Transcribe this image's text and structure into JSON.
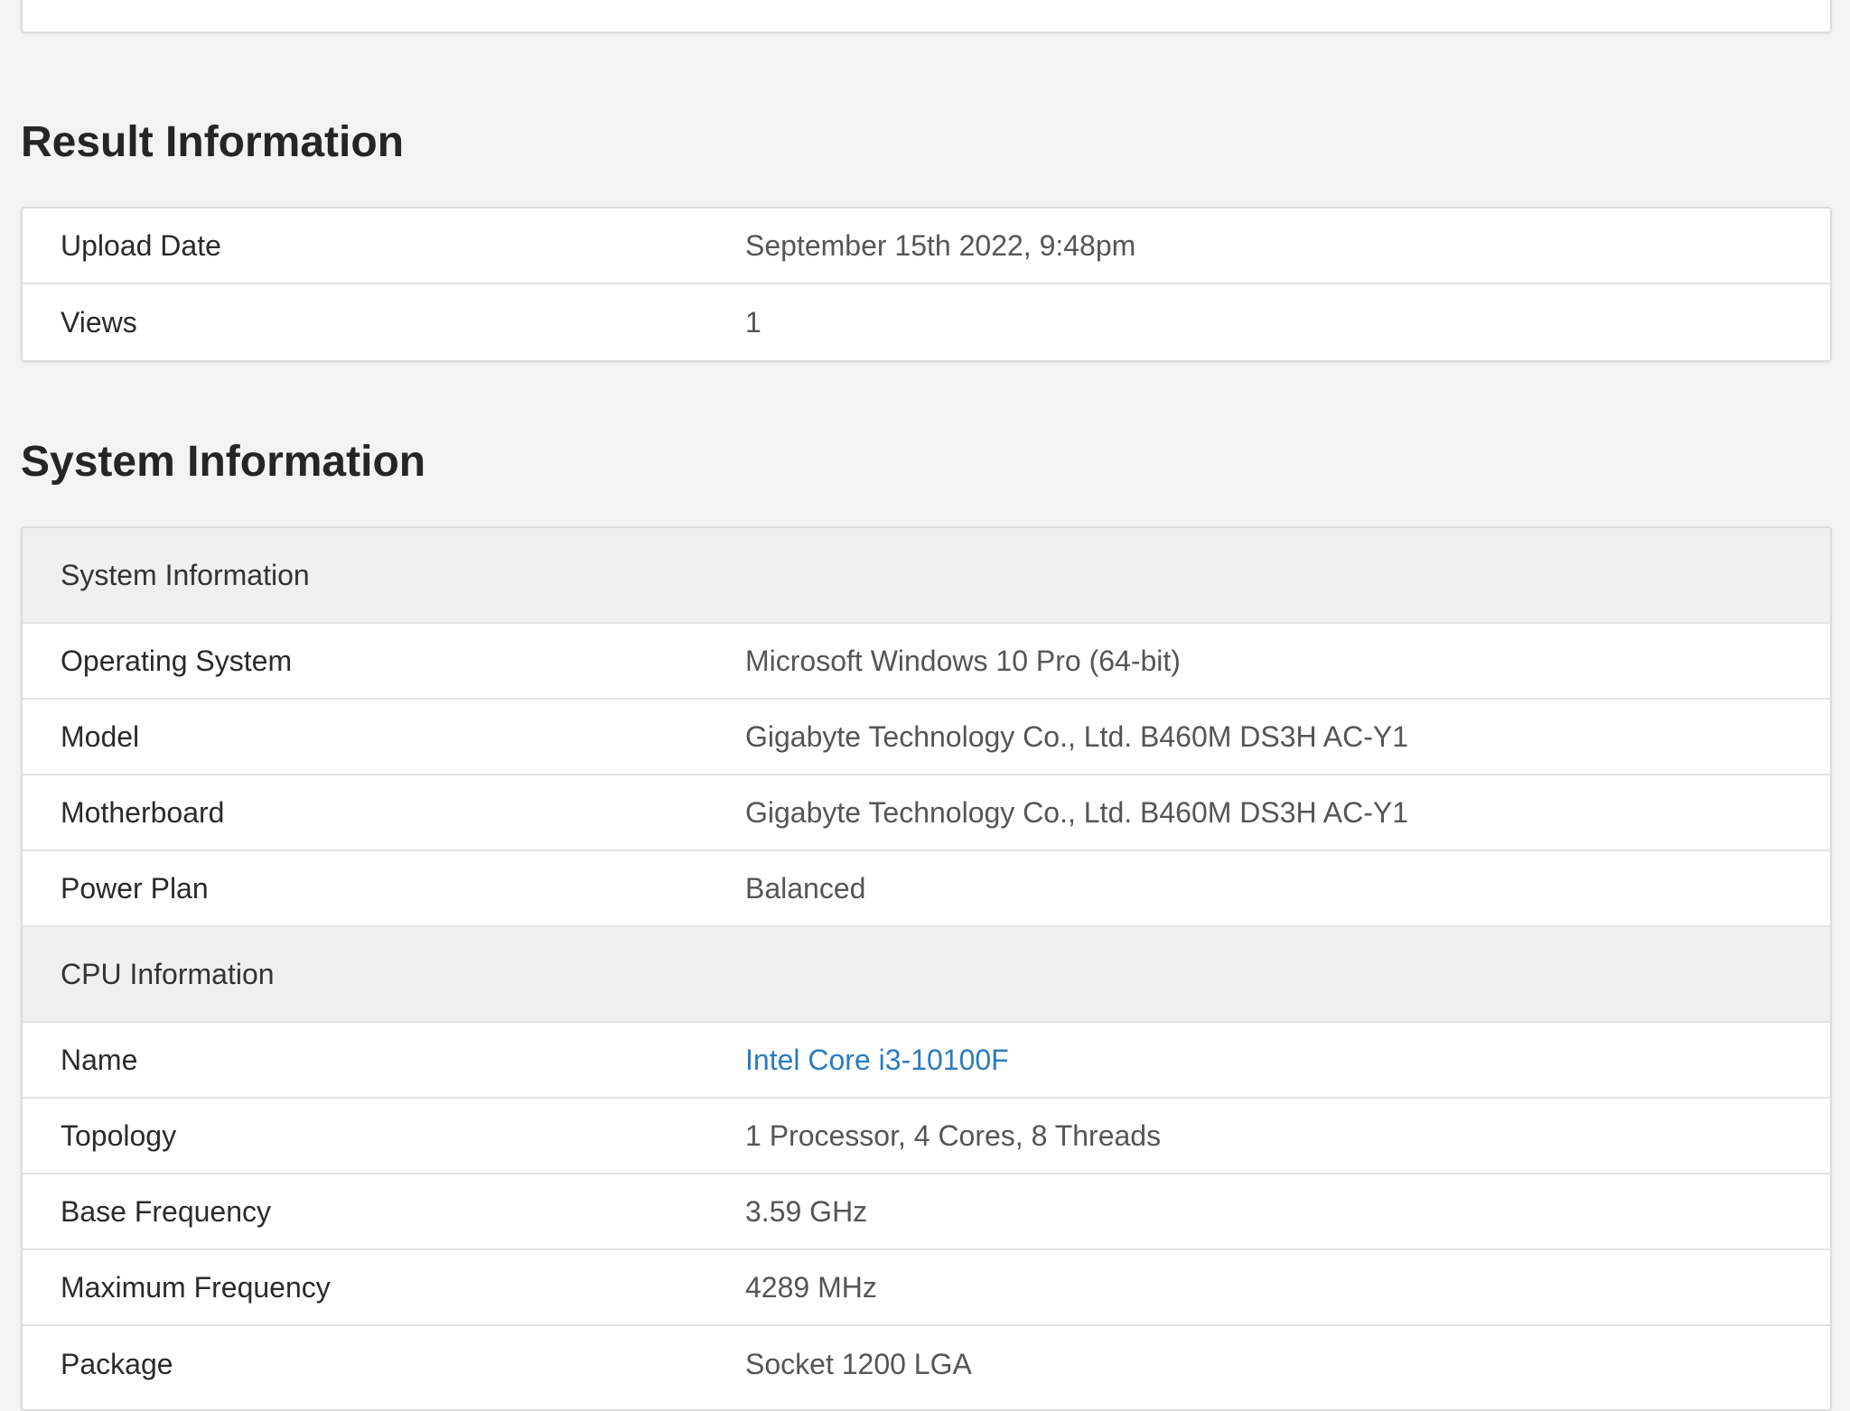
{
  "result_section": {
    "title": "Result Information",
    "rows": [
      {
        "label": "Upload Date",
        "value": "September 15th 2022, 9:48pm"
      },
      {
        "label": "Views",
        "value": "1"
      }
    ]
  },
  "system_section": {
    "title": "System Information",
    "groups": [
      {
        "header": "System Information",
        "rows": [
          {
            "label": "Operating System",
            "value": "Microsoft Windows 10 Pro (64-bit)"
          },
          {
            "label": "Model",
            "value": "Gigabyte Technology Co., Ltd. B460M DS3H AC-Y1"
          },
          {
            "label": "Motherboard",
            "value": "Gigabyte Technology Co., Ltd. B460M DS3H AC-Y1"
          },
          {
            "label": "Power Plan",
            "value": "Balanced"
          }
        ]
      },
      {
        "header": "CPU Information",
        "rows": [
          {
            "label": "Name",
            "value": "Intel Core i3-10100F"
          },
          {
            "label": "Topology",
            "value": "1 Processor, 4 Cores, 8 Threads"
          },
          {
            "label": "Base Frequency",
            "value": "3.59 GHz"
          },
          {
            "label": "Maximum Frequency",
            "value": "4289 MHz"
          },
          {
            "label": "Package",
            "value": "Socket 1200 LGA"
          }
        ]
      }
    ]
  },
  "colors": {
    "background": "#f3f3f3",
    "link": "#2a7bbf",
    "group_header_bg": "#f0f0f0"
  }
}
